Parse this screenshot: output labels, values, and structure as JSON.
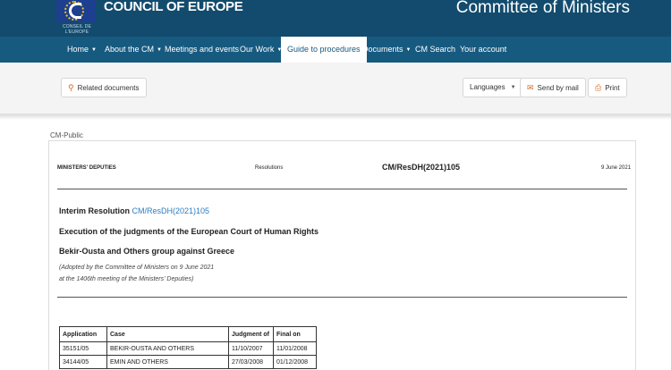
{
  "header": {
    "logo_caption": "CONSEIL DE L'EUROPE",
    "brand": "COUNCIL OF EUROPE",
    "site_title": "Committee of Ministers"
  },
  "nav": {
    "items": [
      {
        "label": "Home",
        "dropdown": true
      },
      {
        "label": "About the CM",
        "dropdown": true
      },
      {
        "label": "Meetings and events",
        "dropdown": false
      },
      {
        "label": "Our Work",
        "dropdown": true
      },
      {
        "label": "Guide to procedures",
        "dropdown": false,
        "active": true
      },
      {
        "label": "Documents",
        "dropdown": true
      },
      {
        "label": "CM Search",
        "dropdown": false
      },
      {
        "label": "Your account",
        "dropdown": false
      }
    ]
  },
  "toolbar": {
    "related": "Related documents",
    "languages": "Languages",
    "send": "Send by mail",
    "print": "Print"
  },
  "document": {
    "classification": "CM-Public",
    "header_left": "MINISTERS' DEPUTIES",
    "header_type": "Resolutions",
    "header_ref": "CM/ResDH(2021)105",
    "header_date": "9 June 2021",
    "interim_label": "Interim Resolution",
    "interim_ref": "CM/ResDH(2021)105",
    "title_line": "Execution of the judgments of the European Court of Human Rights",
    "group_line": "Bekir-Ousta and Others group against Greece",
    "adopted_line1": "(Adopted by the Committee of Ministers on 9 June 2021",
    "adopted_line2": "at the 1406th meeting of the Ministers' Deputies)"
  },
  "table": {
    "headers": [
      "Application",
      "Case",
      "Judgment of",
      "Final on"
    ],
    "rows": [
      [
        "35151/05",
        "BEKIR-OUSTA AND OTHERS",
        "11/10/2007",
        "11/01/2008"
      ],
      [
        "34144/05",
        "EMIN AND OTHERS",
        "27/03/2008",
        "01/12/2008"
      ]
    ]
  },
  "colors": {
    "header_bg": "#124b6d",
    "nav_bg": "#175a80",
    "link": "#2b7dbf",
    "icon_accent": "#d2691e"
  }
}
